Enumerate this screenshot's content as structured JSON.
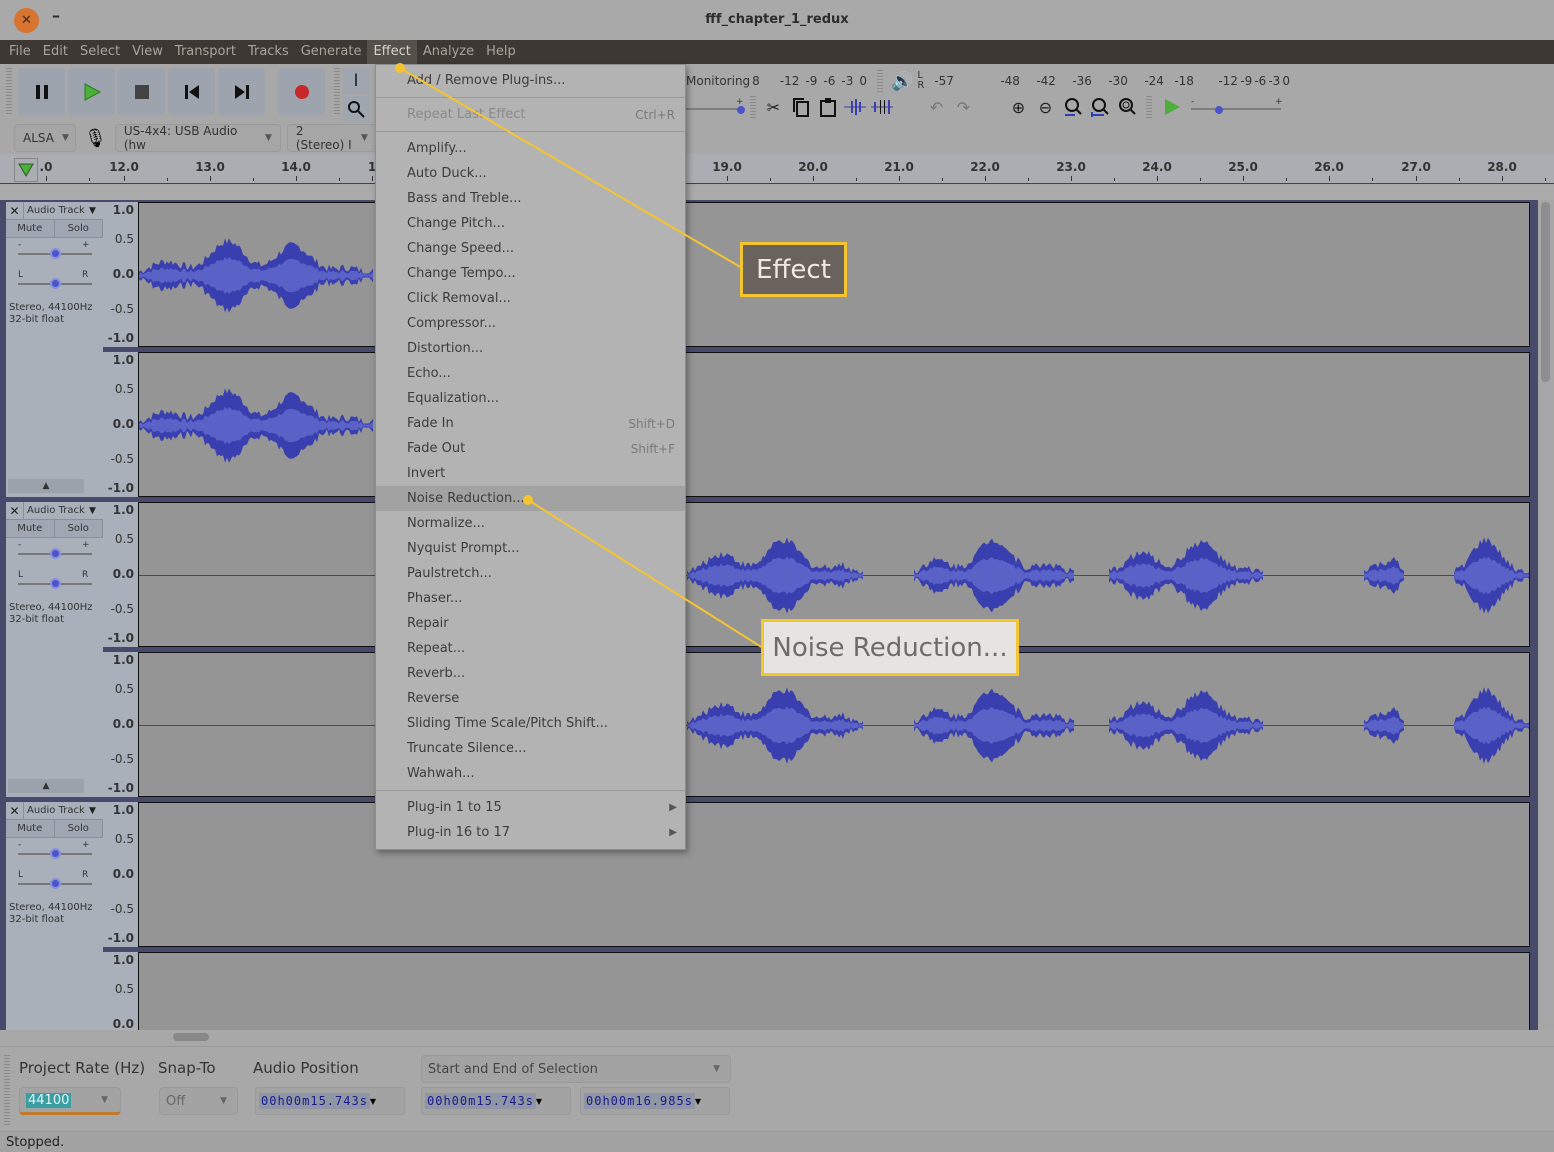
{
  "window": {
    "title": "fff_chapter_1_redux"
  },
  "menubar": {
    "items": [
      "File",
      "Edit",
      "Select",
      "View",
      "Transport",
      "Tracks",
      "Generate",
      "Effect",
      "Analyze",
      "Help"
    ],
    "active": "Effect"
  },
  "toolbar": {
    "transport": [
      "pause",
      "play",
      "stop",
      "skip-to-start",
      "skip-to-end",
      "record"
    ],
    "monitoring_label": "Monitoring",
    "record_meter_scale": [
      "8",
      "-12",
      "-9",
      "-6",
      "-3",
      "0"
    ],
    "playback_meter_scale": [
      "-57",
      "-48",
      "-42",
      "-36",
      "-30",
      "-24",
      "-18",
      "-12",
      "-9",
      "-6",
      "-3",
      "0"
    ],
    "meter_lr": [
      "L",
      "R"
    ],
    "audio_host": "ALSA",
    "recording_device": "US-4x4: USB Audio (hw",
    "recording_channels": "2 (Stereo) I"
  },
  "ruler": {
    "ticks": [
      ".0",
      "12.0",
      "13.0",
      "14.0",
      "1",
      "19.0",
      "20.0",
      "21.0",
      "22.0",
      "23.0",
      "24.0",
      "25.0",
      "26.0",
      "27.0",
      "28.0"
    ]
  },
  "tracks": [
    {
      "name": "Audio Track",
      "mute": "Mute",
      "solo": "Solo",
      "gain_minus": "-",
      "gain_plus": "+",
      "pan_l": "L",
      "pan_r": "R",
      "info_line1": "Stereo, 44100Hz",
      "info_line2": "32-bit float",
      "gain": 0.5,
      "pan": 0.5
    },
    {
      "name": "Audio Track",
      "mute": "Mute",
      "solo": "Solo",
      "gain_minus": "-",
      "gain_plus": "+",
      "pan_l": "L",
      "pan_r": "R",
      "info_line1": "Stereo, 44100Hz",
      "info_line2": "32-bit float",
      "gain": 0.5,
      "pan": 0.5
    },
    {
      "name": "Audio Track",
      "mute": "Mute",
      "solo": "Solo",
      "gain_minus": "-",
      "gain_plus": "+",
      "pan_l": "L",
      "pan_r": "R",
      "info_line1": "Stereo, 44100Hz",
      "info_line2": "32-bit float",
      "gain": 0.5,
      "pan": 0.5
    }
  ],
  "amplitude_labels": [
    "1.0",
    "0.5",
    "0.0",
    "-0.5",
    "-1.0"
  ],
  "effect_menu": {
    "items": [
      {
        "label": "Add / Remove Plug-ins...",
        "shortcut": ""
      },
      {
        "label": "Repeat Last Effect",
        "shortcut": "Ctrl+R",
        "disabled": true
      },
      {
        "label": "Amplify...",
        "shortcut": ""
      },
      {
        "label": "Auto Duck...",
        "shortcut": ""
      },
      {
        "label": "Bass and Treble...",
        "shortcut": ""
      },
      {
        "label": "Change Pitch...",
        "shortcut": ""
      },
      {
        "label": "Change Speed...",
        "shortcut": ""
      },
      {
        "label": "Change Tempo...",
        "shortcut": ""
      },
      {
        "label": "Click Removal...",
        "shortcut": ""
      },
      {
        "label": "Compressor...",
        "shortcut": ""
      },
      {
        "label": "Distortion...",
        "shortcut": ""
      },
      {
        "label": "Echo...",
        "shortcut": ""
      },
      {
        "label": "Equalization...",
        "shortcut": ""
      },
      {
        "label": "Fade In",
        "shortcut": "Shift+D"
      },
      {
        "label": "Fade Out",
        "shortcut": "Shift+F"
      },
      {
        "label": "Invert",
        "shortcut": ""
      },
      {
        "label": "Noise Reduction...",
        "shortcut": "",
        "highlighted": true
      },
      {
        "label": "Normalize...",
        "shortcut": ""
      },
      {
        "label": "Nyquist Prompt...",
        "shortcut": ""
      },
      {
        "label": "Paulstretch...",
        "shortcut": ""
      },
      {
        "label": "Phaser...",
        "shortcut": ""
      },
      {
        "label": "Repair",
        "shortcut": ""
      },
      {
        "label": "Repeat...",
        "shortcut": ""
      },
      {
        "label": "Reverb...",
        "shortcut": ""
      },
      {
        "label": "Reverse",
        "shortcut": ""
      },
      {
        "label": "Sliding Time Scale/Pitch Shift...",
        "shortcut": ""
      },
      {
        "label": "Truncate Silence...",
        "shortcut": ""
      },
      {
        "label": "Wahwah...",
        "shortcut": ""
      },
      {
        "label": "Plug-in 1 to 15",
        "submenu": true
      },
      {
        "label": "Plug-in 16 to 17",
        "submenu": true
      }
    ]
  },
  "annotations": {
    "effect_callout": "Effect",
    "noise_reduction_callout": "Noise Reduction...",
    "color": "#f5c431"
  },
  "selection_toolbar": {
    "project_rate_label": "Project Rate (Hz)",
    "project_rate_value": "44100",
    "snap_to_label": "Snap-To",
    "snap_to_value": "Off",
    "audio_position_label": "Audio Position",
    "audio_position_value": "00h00m15.743s",
    "selection_mode": "Start and End of Selection",
    "selection_start": "00h00m15.743s",
    "selection_end": "00h00m16.985s"
  },
  "status": {
    "text": "Stopped."
  },
  "colors": {
    "waveform": "#3a3fb0",
    "waveform_rms": "#5a62c8",
    "menubar": "#3d3833",
    "callout_border": "#f5c431"
  }
}
